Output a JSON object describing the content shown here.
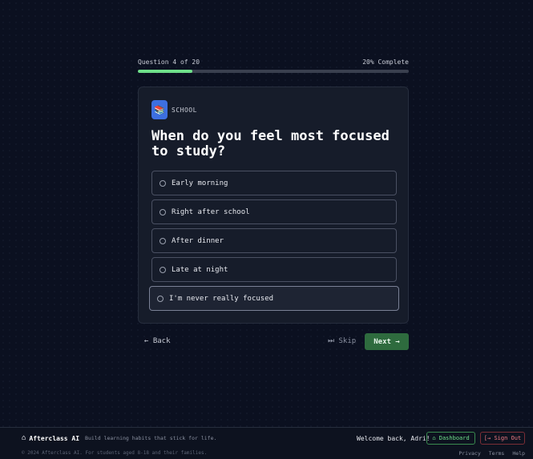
{
  "progress": {
    "label": "Question 4 of 20",
    "complete_label": "20% Complete",
    "fraction": 0.2
  },
  "card": {
    "category_icon": "📚",
    "category": "SCHOOL",
    "question": "When do you feel most focused to study?",
    "options": [
      "Early morning",
      "Right after school",
      "After dinner",
      "Late at night",
      "I'm never really focused"
    ]
  },
  "nav": {
    "back": "← Back",
    "skip": "⏭ Skip",
    "next": "Next →"
  },
  "footer": {
    "brand_icon": "⌂",
    "brand": "Afterclass AI",
    "tagline": "Build learning habits that stick for life.",
    "welcome": "Welcome back, Adri!",
    "dashboard": "⌂ Dashboard",
    "sign_out": "[→ Sign Out",
    "copyright": "© 2024 Afterclass AI. For students aged 8-18 and their families.",
    "links": [
      "Privacy",
      "Terms",
      "Help"
    ]
  },
  "colors": {
    "accent": "#6ee08a",
    "next_button": "#2e6b3e",
    "sign_out": "#f07b84"
  }
}
